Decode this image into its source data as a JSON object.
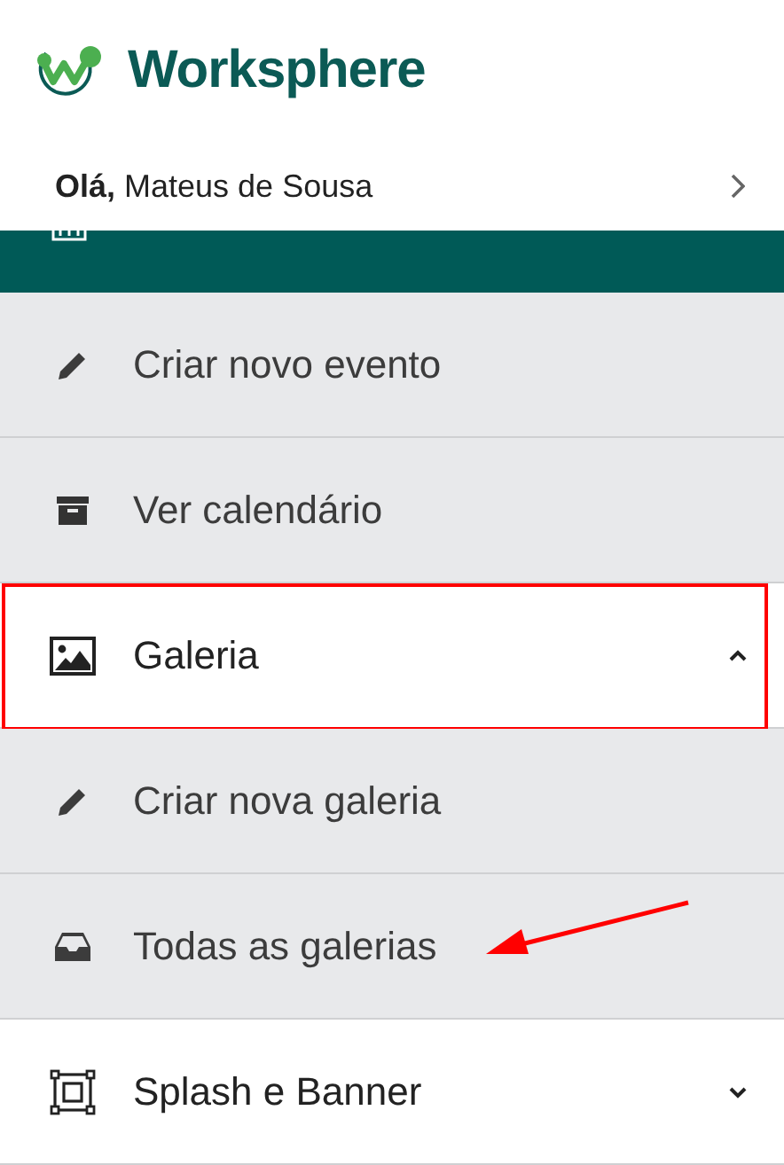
{
  "brand": {
    "name": "Worksphere"
  },
  "greeting": {
    "salutation": "Olá,",
    "name": "Mateus de Sousa"
  },
  "menu": [
    {
      "kind": "sub",
      "label": "Criar novo evento",
      "highlighted": false,
      "pointed": false
    },
    {
      "kind": "sub",
      "label": "Ver calendário",
      "highlighted": false,
      "pointed": false
    },
    {
      "kind": "parent",
      "label": "Galeria",
      "expanded": true,
      "highlighted": true,
      "pointed": false
    },
    {
      "kind": "sub",
      "label": "Criar nova galeria",
      "highlighted": false,
      "pointed": false
    },
    {
      "kind": "sub",
      "label": "Todas as galerias",
      "highlighted": false,
      "pointed": true
    },
    {
      "kind": "parent",
      "label": "Splash e Banner",
      "expanded": false,
      "highlighted": false,
      "pointed": false
    }
  ]
}
